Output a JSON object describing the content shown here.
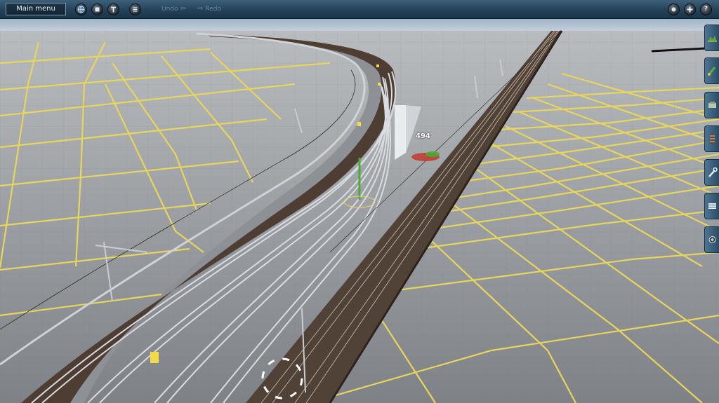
{
  "toolbar": {
    "main_menu_label": "Main menu",
    "undo_label": "Undo",
    "redo_label": "Redo",
    "left_buttons": [
      "globe-icon",
      "stop-icon",
      "text-icon",
      "list-icon"
    ],
    "right_buttons": [
      "camera-icon",
      "plus-icon",
      "help-icon"
    ]
  },
  "viewport": {
    "height_readout": "494"
  },
  "side_tabs": [
    "terrain-icon",
    "paint-icon",
    "objects-icon",
    "track-icon",
    "tools-icon",
    "layers-icon",
    "settings-icon"
  ],
  "colors": {
    "toolbar": "#24425a",
    "grid_line": "#e8d75a",
    "ground": "#8f9398",
    "ballast": "#4a3b30",
    "rail": "#d8dde2"
  }
}
